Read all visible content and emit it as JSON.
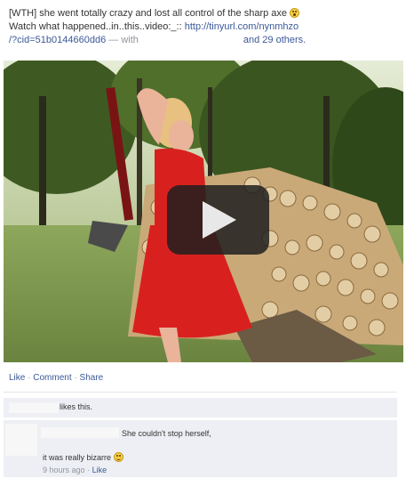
{
  "post": {
    "line1": "[WTH] she went totally crazy and lost all control of the sharp axe",
    "line2_text": "Watch what happened..in..this..video:_::",
    "line2_url": "http://tinyurl.com/nynmhzo",
    "line3_url": "/?cid=51b0144660dd6",
    "line3_with": "— with",
    "line3_others": "and 29 others.",
    "emoji_icon": "surprised-face-icon"
  },
  "video": {
    "play_icon": "play-button-icon"
  },
  "actions": {
    "like": "Like",
    "comment": "Comment",
    "share": "Share",
    "sep": "·"
  },
  "likes": {
    "text": "likes this."
  },
  "comment": {
    "line1": "She couldn't stop herself,",
    "line2": "it was really bizarre",
    "emoji_icon": "smile-face-icon",
    "time": "9 hours ago",
    "sep": "·",
    "like": "Like"
  },
  "colors": {
    "link": "#3b5998",
    "muted": "#90949c",
    "dress": "#d8211e",
    "comment_bg": "#edeff4"
  }
}
